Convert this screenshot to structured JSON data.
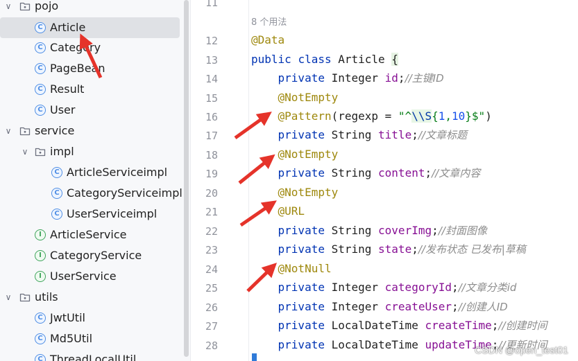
{
  "project_tree": {
    "items": [
      {
        "label": "pojo",
        "kind": "folder",
        "depth": 0,
        "expanded": true,
        "selected": false
      },
      {
        "label": "Article",
        "kind": "class",
        "depth": 1,
        "selected": true
      },
      {
        "label": "Category",
        "kind": "class",
        "depth": 1,
        "selected": false
      },
      {
        "label": "PageBean",
        "kind": "class",
        "depth": 1,
        "selected": false
      },
      {
        "label": "Result",
        "kind": "class",
        "depth": 1,
        "selected": false
      },
      {
        "label": "User",
        "kind": "class",
        "depth": 1,
        "selected": false
      },
      {
        "label": "service",
        "kind": "folder",
        "depth": 0,
        "expanded": true,
        "selected": false
      },
      {
        "label": "impl",
        "kind": "folder",
        "depth": 1,
        "expanded": true,
        "selected": false
      },
      {
        "label": "ArticleServiceimpl",
        "kind": "class",
        "depth": 2,
        "selected": false
      },
      {
        "label": "CategoryServiceimpl",
        "kind": "class",
        "depth": 2,
        "selected": false
      },
      {
        "label": "UserServiceimpl",
        "kind": "class",
        "depth": 2,
        "selected": false
      },
      {
        "label": "ArticleService",
        "kind": "interface",
        "depth": 1,
        "selected": false
      },
      {
        "label": "CategoryService",
        "kind": "interface",
        "depth": 1,
        "selected": false
      },
      {
        "label": "UserService",
        "kind": "interface",
        "depth": 1,
        "selected": false
      },
      {
        "label": "utils",
        "kind": "folder",
        "depth": 0,
        "expanded": true,
        "selected": false
      },
      {
        "label": "JwtUtil",
        "kind": "class",
        "depth": 1,
        "selected": false
      },
      {
        "label": "Md5Util",
        "kind": "class",
        "depth": 1,
        "selected": false
      },
      {
        "label": "ThreadLocalUtil",
        "kind": "class",
        "depth": 1,
        "selected": false
      }
    ],
    "icons": {
      "folder": "folder-icon",
      "class": "class-c-icon",
      "interface": "interface-i-icon",
      "expanded": "chevron-down-icon"
    },
    "class_glyph": "C",
    "interface_glyph": "I"
  },
  "editor": {
    "usages_hint": "8 个用法",
    "lines": [
      {
        "number": "11",
        "tokens": []
      },
      {
        "number": "12",
        "tokens": [
          {
            "t": "@Data",
            "c": "an"
          }
        ]
      },
      {
        "number": "13",
        "tokens": [
          {
            "t": "public ",
            "c": "kw"
          },
          {
            "t": "class ",
            "c": "kw"
          },
          {
            "t": "Article ",
            "c": ""
          },
          {
            "t": "{",
            "c": "brace"
          }
        ]
      },
      {
        "number": "14",
        "tokens": [
          {
            "t": "    private ",
            "c": "kw"
          },
          {
            "t": "Integer ",
            "c": ""
          },
          {
            "t": "id",
            "c": "fd"
          },
          {
            "t": ";",
            "c": ""
          },
          {
            "t": "//主键ID",
            "c": "cm"
          }
        ]
      },
      {
        "number": "15",
        "tokens": [
          {
            "t": "    @NotEmpty",
            "c": "an"
          }
        ]
      },
      {
        "number": "16",
        "tokens": [
          {
            "t": "    @Pattern",
            "c": "an"
          },
          {
            "t": "(regexp = ",
            "c": ""
          },
          {
            "t": "\"^",
            "c": "st"
          },
          {
            "t": "\\\\S",
            "c": "esc"
          },
          {
            "t": "{",
            "c": "st"
          },
          {
            "t": "1",
            "c": "num"
          },
          {
            "t": ",",
            "c": "st"
          },
          {
            "t": "10",
            "c": "num"
          },
          {
            "t": "}$\"",
            "c": "st"
          },
          {
            "t": ")",
            "c": ""
          }
        ]
      },
      {
        "number": "17",
        "tokens": [
          {
            "t": "    private ",
            "c": "kw"
          },
          {
            "t": "String ",
            "c": ""
          },
          {
            "t": "title",
            "c": "fd"
          },
          {
            "t": ";",
            "c": ""
          },
          {
            "t": "//文章标题",
            "c": "cm"
          }
        ]
      },
      {
        "number": "18",
        "tokens": [
          {
            "t": "    @NotEmpty",
            "c": "an"
          }
        ]
      },
      {
        "number": "19",
        "tokens": [
          {
            "t": "    private ",
            "c": "kw"
          },
          {
            "t": "String ",
            "c": ""
          },
          {
            "t": "content",
            "c": "fd"
          },
          {
            "t": ";",
            "c": ""
          },
          {
            "t": "//文章内容",
            "c": "cm"
          }
        ]
      },
      {
        "number": "20",
        "tokens": [
          {
            "t": "    @NotEmpty",
            "c": "an"
          }
        ]
      },
      {
        "number": "21",
        "tokens": [
          {
            "t": "    @URL",
            "c": "an"
          }
        ]
      },
      {
        "number": "22",
        "tokens": [
          {
            "t": "    private ",
            "c": "kw"
          },
          {
            "t": "String ",
            "c": ""
          },
          {
            "t": "coverImg",
            "c": "fd"
          },
          {
            "t": ";",
            "c": ""
          },
          {
            "t": "//封面图像",
            "c": "cm"
          }
        ]
      },
      {
        "number": "23",
        "tokens": [
          {
            "t": "    private ",
            "c": "kw"
          },
          {
            "t": "String ",
            "c": ""
          },
          {
            "t": "state",
            "c": "fd"
          },
          {
            "t": ";",
            "c": ""
          },
          {
            "t": "//发布状态 已发布|草稿",
            "c": "cm"
          }
        ]
      },
      {
        "number": "24",
        "tokens": [
          {
            "t": "    @NotNull",
            "c": "an"
          }
        ]
      },
      {
        "number": "25",
        "tokens": [
          {
            "t": "    private ",
            "c": "kw"
          },
          {
            "t": "Integer ",
            "c": ""
          },
          {
            "t": "categoryId",
            "c": "fd"
          },
          {
            "t": ";",
            "c": ""
          },
          {
            "t": "//文章分类id",
            "c": "cm"
          }
        ]
      },
      {
        "number": "26",
        "tokens": [
          {
            "t": "    private ",
            "c": "kw"
          },
          {
            "t": "Integer ",
            "c": ""
          },
          {
            "t": "createUser",
            "c": "fd"
          },
          {
            "t": ";",
            "c": ""
          },
          {
            "t": "//创建人ID",
            "c": "cm"
          }
        ]
      },
      {
        "number": "27",
        "tokens": [
          {
            "t": "    private ",
            "c": "kw"
          },
          {
            "t": "LocalDateTime ",
            "c": ""
          },
          {
            "t": "createTime",
            "c": "fd"
          },
          {
            "t": ";",
            "c": ""
          },
          {
            "t": "//创建时间",
            "c": "cm"
          }
        ]
      },
      {
        "number": "28",
        "tokens": [
          {
            "t": "    private ",
            "c": "kw"
          },
          {
            "t": "LocalDateTime ",
            "c": ""
          },
          {
            "t": "updateTime",
            "c": "fd"
          },
          {
            "t": ";",
            "c": ""
          },
          {
            "t": "//更新时间",
            "c": "cm"
          }
        ]
      }
    ]
  },
  "annotation_arrows": {
    "color": "#e5332a",
    "count": 5
  },
  "watermark": "CSDN @open_test01"
}
